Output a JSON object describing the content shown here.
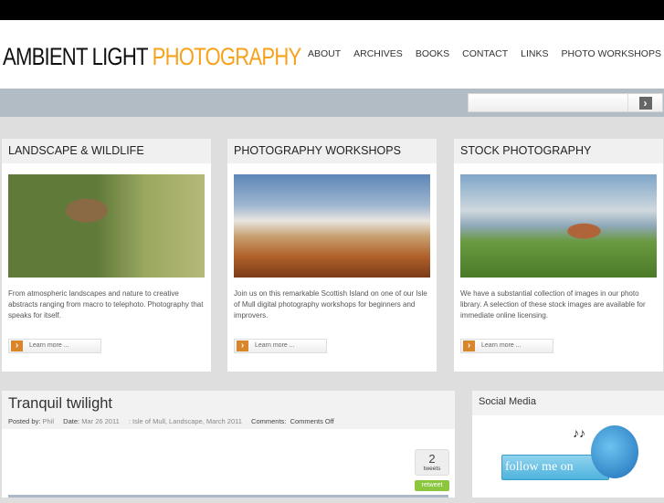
{
  "header": {
    "logo_part1": "AMBIENT LIGHT",
    "logo_part2": "PHOTOGRAPHY",
    "nav": [
      "ABOUT",
      "ARCHIVES",
      "BOOKS",
      "CONTACT",
      "LINKS",
      "PHOTO WORKSHOPS"
    ]
  },
  "search": {
    "placeholder": "",
    "button_icon": "chevron-right-icon"
  },
  "cards": [
    {
      "title": "LANDSCAPE & WILDLIFE",
      "text": "From atmospheric landscapes and nature to creative abstracts ranging from macro to telephoto. Photography that speaks for itself.",
      "button": "Learn more ..."
    },
    {
      "title": "PHOTOGRAPHY WORKSHOPS",
      "text": "Join us on this remarkable Scottish Island on one of our Isle of Mull digital photography workshops for beginners and improvers.",
      "button": "Learn more ..."
    },
    {
      "title": "STOCK PHOTOGRAPHY",
      "text": "We have a substantial collection of images in our photo library. A selection of these stock images are available for immediate online licensing.",
      "button": "Learn more ..."
    }
  ],
  "post": {
    "title": "Tranquil twilight",
    "posted_by_label": "Posted by:",
    "author": "Phil",
    "date_label": "Date:",
    "date": "Mar 26 2011",
    "categories": ": Isle of Mull, Landscape, March 2011",
    "comments_label": "Comments:",
    "comments": "Comments Off",
    "tweet_count": "2",
    "tweets_label": "tweets",
    "retweet": "retweet"
  },
  "sidebar": {
    "title": "Social Media",
    "twitter_badge": "follow me on twitter"
  },
  "colors": {
    "accent": "#f7a21b",
    "band": "#b2bcc5",
    "retweet": "#8cc63f"
  }
}
